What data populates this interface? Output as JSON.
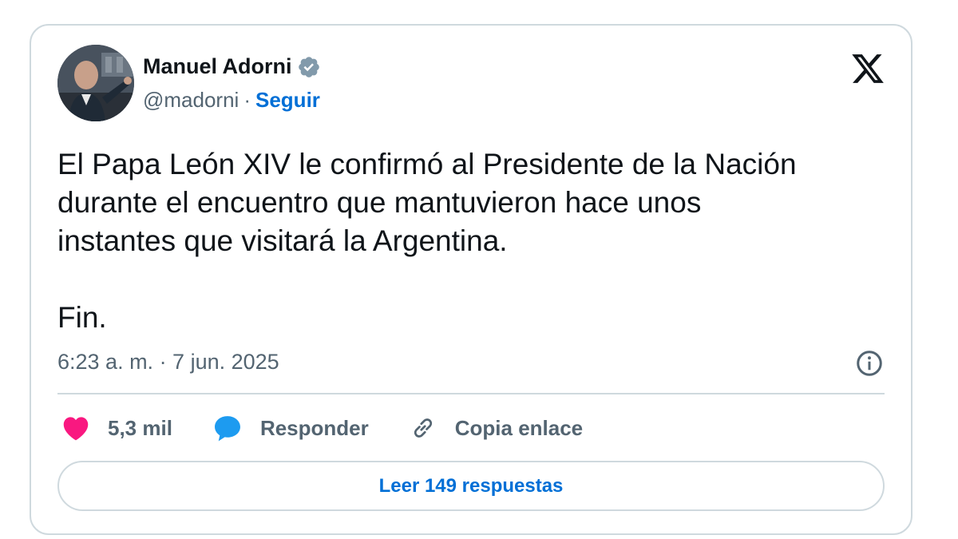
{
  "author": {
    "display_name": "Manuel Adorni",
    "handle": "@madorni",
    "separator": "·",
    "follow_label": "Seguir"
  },
  "tweet": {
    "text": "El Papa León XIV le confirmó al Presidente de la Nación\ndurante el encuentro que mantuvieron hace unos\ninstantes que visitará la Argentina.\n\nFin.",
    "timestamp": "6:23 a. m. · 7 jun. 2025"
  },
  "actions": {
    "likes_count": "5,3 mil",
    "reply_label": "Responder",
    "copy_link_label": "Copia enlace"
  },
  "read_replies_label": "Leer 149 respuestas",
  "icons": {
    "verified": "verified-badge-icon",
    "x_logo": "x-logo-icon",
    "info": "info-icon",
    "like": "heart-icon",
    "reply": "speech-bubble-icon",
    "copy": "link-icon"
  },
  "colors": {
    "link_blue": "#006fd6",
    "heart_pink": "#f91880",
    "reply_blue": "#1d9bf0",
    "verified_gray": "#829aab",
    "secondary_text": "#536471"
  }
}
